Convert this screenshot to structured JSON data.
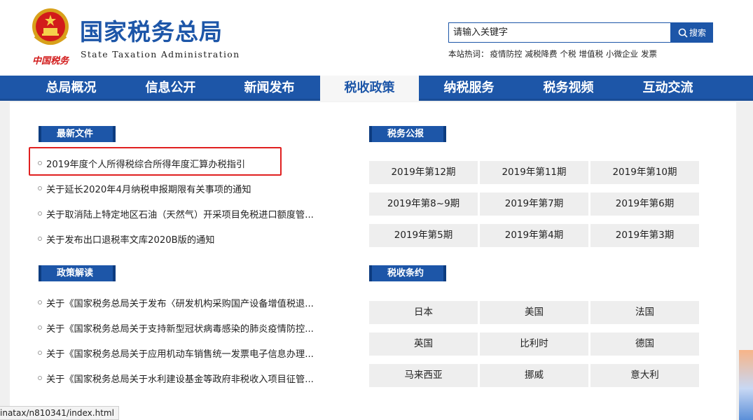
{
  "header": {
    "emblem_text": "中国税务",
    "title": "国家税务总局",
    "subtitle": "State Taxation Administration",
    "search": {
      "placeholder": "请输入关键字",
      "button_label": "搜索"
    },
    "hotwords_label": "本站热词：",
    "hotwords": [
      "疫情防控",
      "减税降费",
      "个税",
      "增值税",
      "小微企业",
      "发票"
    ]
  },
  "nav": {
    "items": [
      "总局概况",
      "信息公开",
      "新闻发布",
      "税收政策",
      "纳税服务",
      "税务视频",
      "互动交流"
    ],
    "active": "税收政策"
  },
  "sections": {
    "latest_files": {
      "title": "最新文件",
      "items": [
        "2019年度个人所得税综合所得年度汇算办税指引",
        "关于延长2020年4月纳税申报期限有关事项的通知",
        "关于取消陆上特定地区石油（天然气）开采项目免税进口额度管...",
        "关于发布出口退税率文库2020B版的通知"
      ]
    },
    "policy_interpretation": {
      "title": "政策解读",
      "items": [
        "关于《国家税务总局关于发布〈研发机构采购国产设备增值税退...",
        "关于《国家税务总局关于支持新型冠状病毒感染的肺炎疫情防控...",
        "关于《国家税务总局关于应用机动车销售统一发票电子信息办理...",
        "关于《国家税务总局关于水利建设基金等政府非税收入项目征管..."
      ]
    },
    "tax_bulletin": {
      "title": "税务公报",
      "items": [
        "2019年第12期",
        "2019年第11期",
        "2019年第10期",
        "2019年第8~9期",
        "2019年第7期",
        "2019年第6期",
        "2019年第5期",
        "2019年第4期",
        "2019年第3期"
      ]
    },
    "tax_treaties": {
      "title": "税收条约",
      "items": [
        "日本",
        "美国",
        "法国",
        "英国",
        "比利时",
        "德国",
        "马来西亚",
        "挪威",
        "意大利"
      ]
    }
  },
  "status_bar": {
    "url": "inatax/n810341/index.html"
  },
  "colors": {
    "brand_blue": "#1d56a8",
    "highlight_red": "#e02020",
    "emblem_red": "#d21b1b"
  }
}
